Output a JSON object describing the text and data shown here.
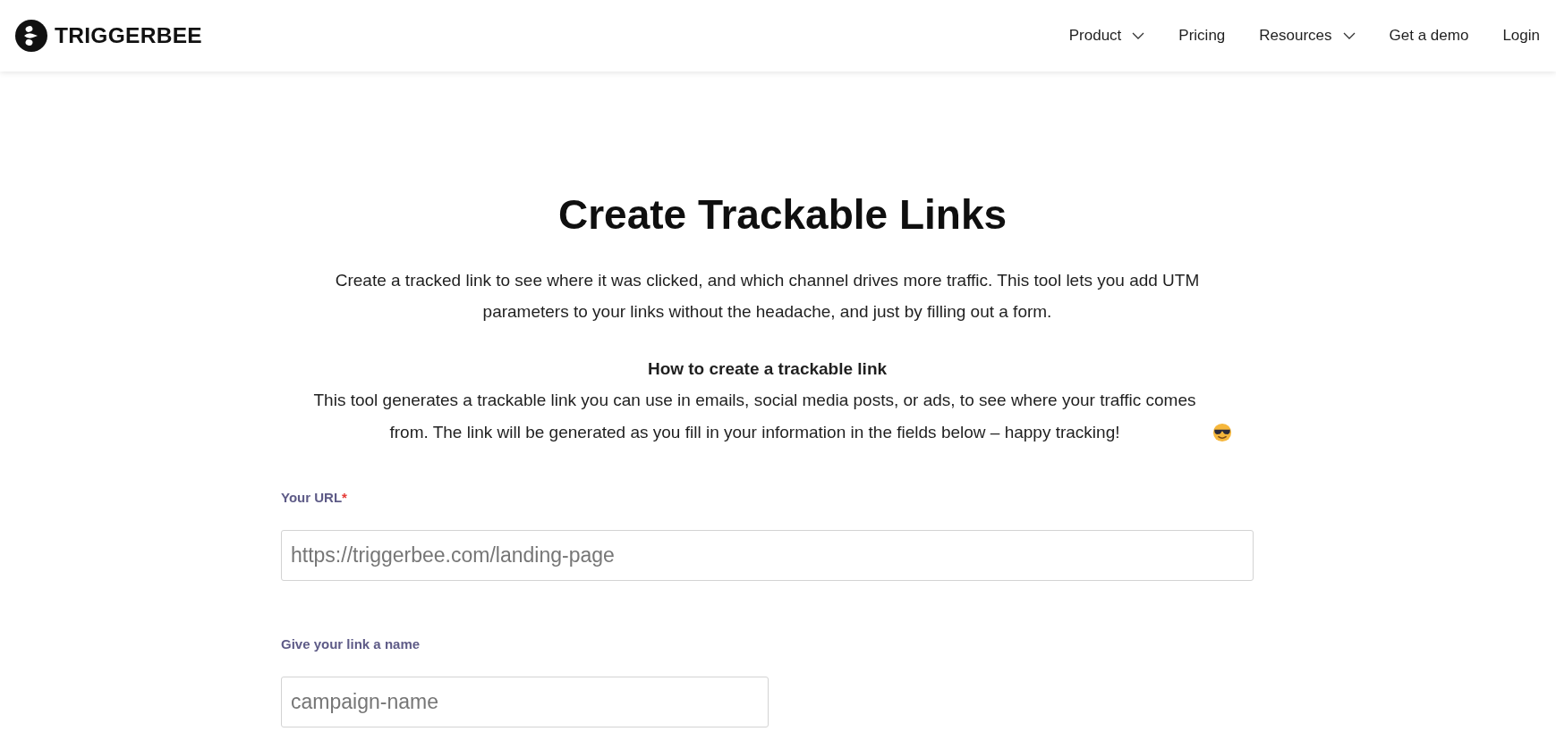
{
  "header": {
    "logo_text": "TRIGGERBEE",
    "nav": [
      {
        "label": "Product",
        "dropdown": true
      },
      {
        "label": "Pricing",
        "dropdown": false
      },
      {
        "label": "Resources",
        "dropdown": true
      },
      {
        "label": "Get a demo",
        "dropdown": false
      },
      {
        "label": "Login",
        "dropdown": false
      }
    ]
  },
  "intro": {
    "title": "Create Trackable Links",
    "description": "Create a tracked link to see where it was clicked, and which channel drives more traffic. This tool lets you add UTM parameters to your links without the headache, and just by filling out a form.",
    "howto_title": "How to create a trackable link",
    "howto_text": "This tool generates a trackable link you can use in emails, social media posts, or ads, to see where your traffic comes from. The link will be generated as you fill in your information in the fields below – happy tracking!"
  },
  "form": {
    "fields": [
      {
        "kind": "url",
        "label": "Your URL",
        "required_mark": "*",
        "placeholder": "https://triggerbee.com/landing-page"
      },
      {
        "kind": "text",
        "label": "Give your link a name",
        "placeholder": "campaign-name"
      }
    ]
  }
}
